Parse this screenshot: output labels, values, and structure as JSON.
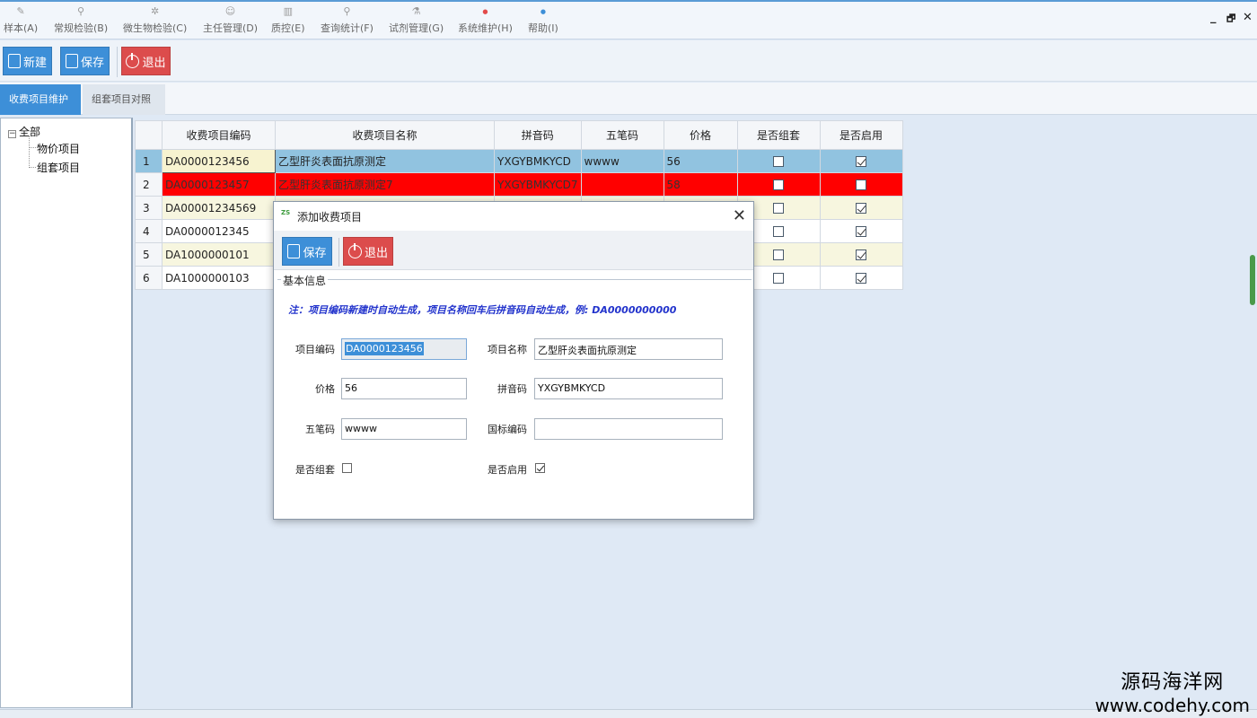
{
  "menu": [
    {
      "label": "样本(A)",
      "icon": "pen-icon"
    },
    {
      "label": "常规检验(B)",
      "icon": "microscope-icon"
    },
    {
      "label": "微生物检验(C)",
      "icon": "bacteria-icon"
    },
    {
      "label": "主任管理(D)",
      "icon": "user-icon"
    },
    {
      "label": "质控(E)",
      "icon": "chart-icon"
    },
    {
      "label": "查询统计(F)",
      "icon": "query-icon"
    },
    {
      "label": "试剂管理(G)",
      "icon": "tube-icon"
    },
    {
      "label": "系统维护(H)",
      "icon": "gear-icon"
    },
    {
      "label": "帮助(I)",
      "icon": "help-icon"
    }
  ],
  "window_controls": {
    "minimize": "_",
    "restore": "🗗",
    "close": "✕"
  },
  "toolbar": {
    "new_label": "新建",
    "save_label": "保存",
    "exit_label": "退出"
  },
  "tabs": [
    {
      "label": "收费项目维护",
      "active": true
    },
    {
      "label": "组套项目对照",
      "active": false
    }
  ],
  "tree": {
    "root": "全部",
    "children": [
      "物价项目",
      "组套项目"
    ]
  },
  "grid": {
    "columns": [
      "收费项目编码",
      "收费项目名称",
      "拼音码",
      "五笔码",
      "价格",
      "是否组套",
      "是否启用"
    ],
    "rows": [
      {
        "no": "1",
        "code": "DA0000123456",
        "name": "乙型肝炎表面抗原测定",
        "pinyin": "YXGYBMKYCD",
        "wubi": "wwww",
        "price": "56",
        "combo": false,
        "enabled": true
      },
      {
        "no": "2",
        "code": "DA0000123457",
        "name": "乙型肝炎表面抗原测定7",
        "pinyin": "YXGYBMKYCD7",
        "wubi": "",
        "price": "58",
        "combo": false,
        "enabled": false
      },
      {
        "no": "3",
        "code": "DA00001234569",
        "name": "",
        "pinyin": "",
        "wubi": "",
        "price": "",
        "combo": false,
        "enabled": true
      },
      {
        "no": "4",
        "code": "DA0000012345",
        "name": "",
        "pinyin": "",
        "wubi": "",
        "price": "",
        "combo": false,
        "enabled": true
      },
      {
        "no": "5",
        "code": "DA1000000101",
        "name": "",
        "pinyin": "",
        "wubi": "",
        "price": "",
        "combo": false,
        "enabled": true
      },
      {
        "no": "6",
        "code": "DA1000000103",
        "name": "",
        "pinyin": "",
        "wubi": "",
        "price": "",
        "combo": false,
        "enabled": true
      }
    ]
  },
  "dialog": {
    "title": "添加收费项目",
    "app_icon_text": "ZS",
    "save_label": "保存",
    "exit_label": "退出",
    "group_title": "基本信息",
    "note": "注：项目编码新建时自动生成，项目名称回车后拼音码自动生成，例: DA0000000000",
    "fields": {
      "code_label": "项目编码",
      "code_value": "DA0000123456",
      "name_label": "项目名称",
      "name_value": "乙型肝炎表面抗原测定",
      "price_label": "价格",
      "price_value": "56",
      "pinyin_label": "拼音码",
      "pinyin_value": "YXGYBMKYCD",
      "wubi_label": "五笔码",
      "wubi_value": "wwww",
      "gb_label": "国标编码",
      "gb_value": "",
      "combo_label": "是否组套",
      "combo_checked": false,
      "enabled_label": "是否启用",
      "enabled_checked": true
    }
  },
  "watermark": {
    "line1": "源码海洋网",
    "line2": "www.codehy.com"
  },
  "colors": {
    "accent_blue": "#3d8fd8",
    "exit_red": "#dc4c4c",
    "selected_row": "#91c3e0",
    "error_row": "#ff0000",
    "alt_row": "#f7f6df",
    "note_text": "#2233cc"
  }
}
